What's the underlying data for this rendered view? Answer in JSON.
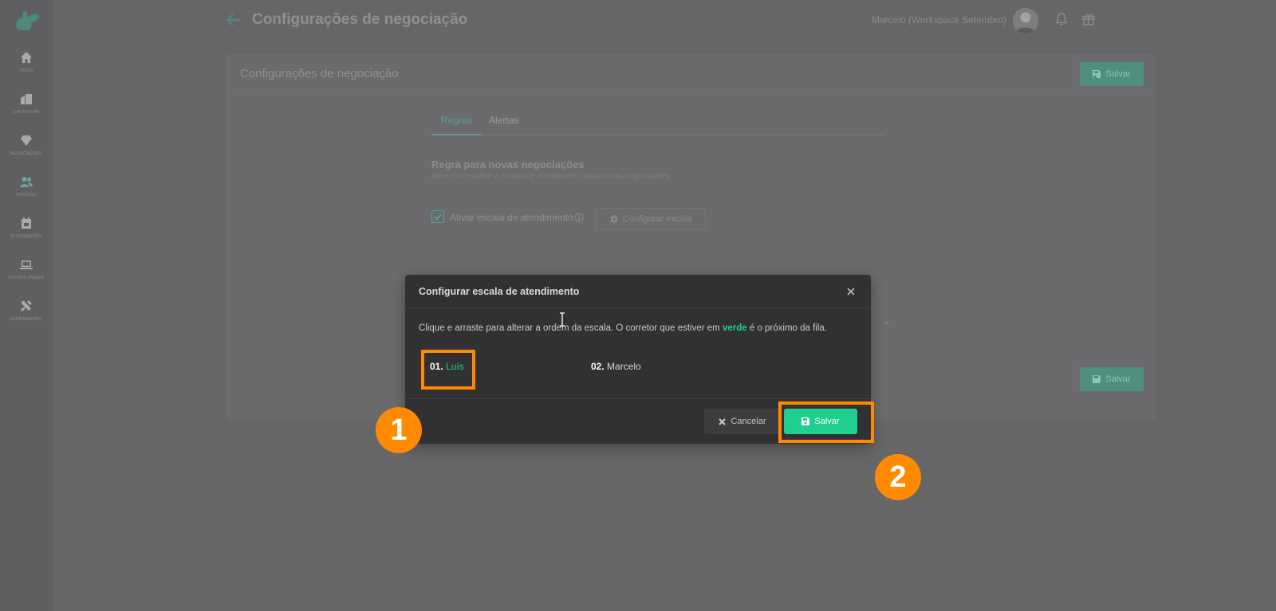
{
  "sidebar": {
    "logo": "squirrel-logo",
    "items": [
      {
        "label": "início",
        "icon": "home-icon"
      },
      {
        "label": "cadastrar",
        "icon": "buildings-icon"
      },
      {
        "label": "negociações",
        "icon": "diamond-icon"
      },
      {
        "label": "pessoas",
        "icon": "people-icon"
      },
      {
        "label": "integrações",
        "icon": "calendar-icon"
      },
      {
        "label": "outros painéis",
        "icon": "laptop-icon"
      },
      {
        "label": "ferramentas",
        "icon": "tools-icon"
      }
    ]
  },
  "header": {
    "title": "Configurações de negociação",
    "user": "Marcelo (Workspace Setembro)"
  },
  "card": {
    "title": "Configurações de negociação",
    "save_label": "Salvar",
    "tabs": [
      "Regras",
      "Alertas"
    ],
    "section_title": "Regra para novas negociações",
    "section_desc": "Ative ou desative a escala de atendimento para novas negociações",
    "checkbox_label": "Ativar escala de atendimento",
    "config_button": "Configurar escala",
    "footer_save_label": "Salvar"
  },
  "modal": {
    "title": "Configurar escala de atendimento",
    "desc_before": "Clique e arraste para alterar a ordem da escala. O corretor que estiver em ",
    "desc_highlight": "verde",
    "desc_after": " é o próximo da fila.",
    "queue": [
      {
        "num": "01.",
        "name": "Luís"
      },
      {
        "num": "02.",
        "name": "Marcelo"
      }
    ],
    "cancel_label": "Cancelar",
    "save_label": "Salvar"
  },
  "annotations": {
    "step1": "1",
    "step2": "2"
  },
  "colors": {
    "accent_green": "#1fcf8f",
    "highlight_orange": "#ff8a00",
    "modal_bg": "#313134"
  }
}
